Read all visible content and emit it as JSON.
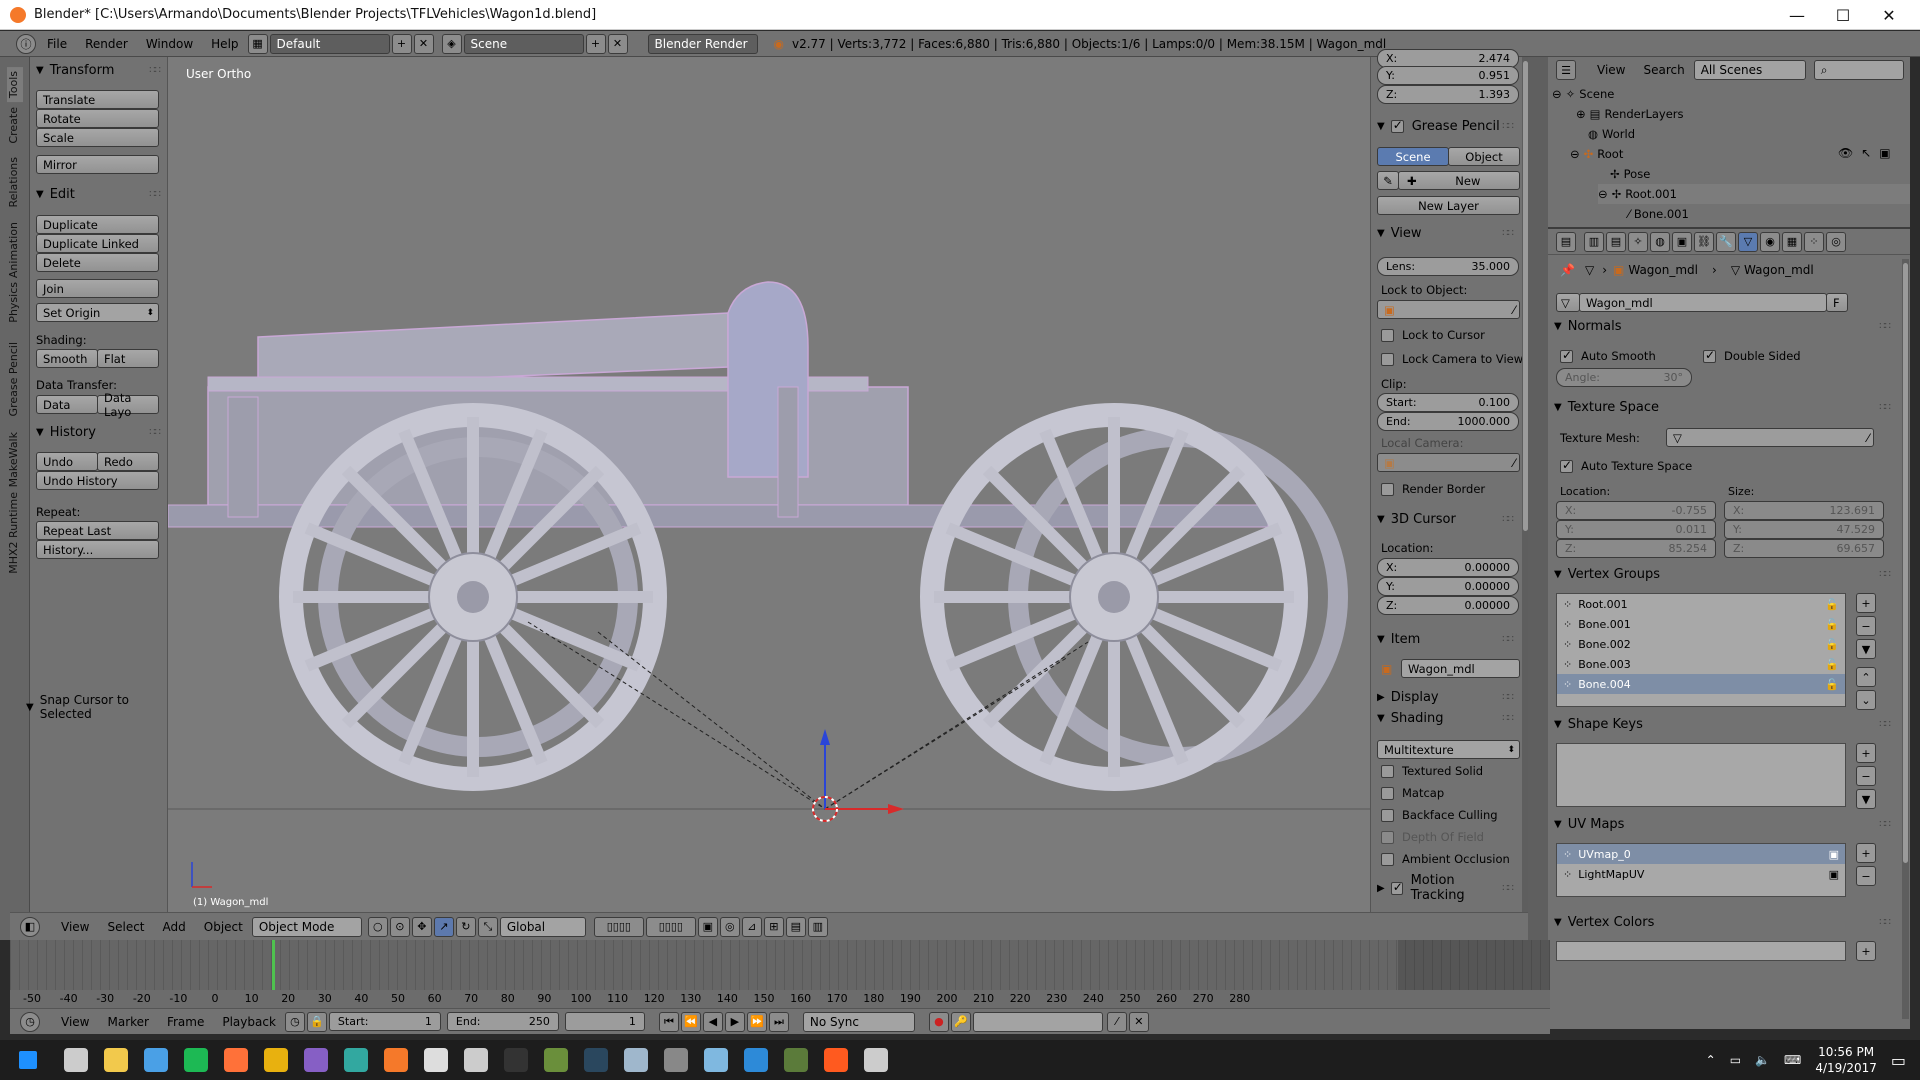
{
  "window": {
    "title": "Blender* [C:\\Users\\Armando\\Documents\\Blender Projects\\TFLVehicles\\Wagon1d.blend]",
    "minimize": "—",
    "maximize": "☐",
    "close": "✕"
  },
  "infobar": {
    "menus": [
      "File",
      "Render",
      "Window",
      "Help"
    ],
    "layout": "Default",
    "scene": "Scene",
    "engine": "Blender Render",
    "stats": "v2.77 | Verts:3,772 | Faces:6,880 | Tris:6,880 | Objects:1/6 | Lamps:0/0 | Mem:38.15M | Wagon_mdl"
  },
  "tool_tabs": [
    "Tools",
    "Create",
    "Relations",
    "Animation",
    "Physics",
    "Grease Pencil",
    "MakeWalk",
    "MHX2 Runtime"
  ],
  "tools": {
    "transform_title": "Transform",
    "transform": [
      "Translate",
      "Rotate",
      "Scale"
    ],
    "mirror": "Mirror",
    "edit_title": "Edit",
    "edit": [
      "Duplicate",
      "Duplicate Linked",
      "Delete"
    ],
    "join": "Join",
    "set_origin": "Set Origin",
    "shading_label": "Shading:",
    "smooth": "Smooth",
    "flat": "Flat",
    "data_transfer_label": "Data Transfer:",
    "data": "Data",
    "data_layo": "Data Layo",
    "history_title": "History",
    "undo": "Undo",
    "redo": "Redo",
    "undo_history": "Undo History",
    "repeat_label": "Repeat:",
    "repeat_last": "Repeat Last",
    "history_btn": "History...",
    "snap": "Snap Cursor to Selected"
  },
  "viewport": {
    "view_name": "User Ortho",
    "object_label": "(1) Wagon_mdl",
    "header": {
      "menus": [
        "View",
        "Select",
        "Add",
        "Object"
      ],
      "mode": "Object Mode",
      "orientation": "Global"
    }
  },
  "npanel": {
    "x_label": "X:",
    "x_val": "2.474",
    "y_label": "Y:",
    "y_val": "0.951",
    "z_label": "Z:",
    "z_val": "1.393",
    "grease_title": "Grease Pencil",
    "gp_scene": "Scene",
    "gp_object": "Object",
    "gp_new": "New",
    "gp_new_layer": "New Layer",
    "view_title": "View",
    "lens_label": "Lens:",
    "lens_val": "35.000",
    "lock_to_object": "Lock to Object:",
    "lock_cursor": "Lock to Cursor",
    "lock_camera": "Lock Camera to View",
    "clip_label": "Clip:",
    "clip_start_label": "Start:",
    "clip_start": "0.100",
    "clip_end_label": "End:",
    "clip_end": "1000.000",
    "local_camera": "Local Camera:",
    "render_border": "Render Border",
    "cursor_title": "3D Cursor",
    "cursor_location": "Location:",
    "cx": "0.00000",
    "cy": "0.00000",
    "cz": "0.00000",
    "item_title": "Item",
    "item_name": "Wagon_mdl",
    "display_title": "Display",
    "shading_title": "Shading",
    "shading_mode": "Multitexture",
    "textured_solid": "Textured Solid",
    "matcap": "Matcap",
    "backface": "Backface Culling",
    "dof": "Depth Of Field",
    "ao": "Ambient Occlusion",
    "motion_tracking": "Motion Tracking"
  },
  "outliner": {
    "view": "View",
    "search": "Search",
    "filter": "All Scenes",
    "rows": [
      "Scene",
      "RenderLayers",
      "World",
      "Root",
      "Pose",
      "Root.001",
      "Bone.001"
    ]
  },
  "props": {
    "breadcrumb_a": "Wagon_mdl",
    "breadcrumb_b": "Wagon_mdl",
    "datablock": "Wagon_mdl",
    "fake_user": "F",
    "normals_title": "Normals",
    "auto_smooth": "Auto Smooth",
    "double_sided": "Double Sided",
    "angle_label": "Angle:",
    "angle_val": "30°",
    "texspace_title": "Texture Space",
    "texture_mesh": "Texture Mesh:",
    "auto_texspace": "Auto Texture Space",
    "location_label": "Location:",
    "size_label": "Size:",
    "loc_x": "-0.755",
    "loc_y": "0.011",
    "loc_z": "85.254",
    "size_x": "123.691",
    "size_y": "47.529",
    "size_z": "69.657",
    "vgroups_title": "Vertex Groups",
    "vgroups": [
      "Root.001",
      "Bone.001",
      "Bone.002",
      "Bone.003",
      "Bone.004"
    ],
    "shapekeys_title": "Shape Keys",
    "uvmaps_title": "UV Maps",
    "uvmaps": [
      "UVmap_0",
      "LightMapUV"
    ],
    "vcolors_title": "Vertex Colors"
  },
  "timeline": {
    "ticks": [
      "-50",
      "-40",
      "-30",
      "-20",
      "-10",
      "0",
      "10",
      "20",
      "30",
      "40",
      "50",
      "60",
      "70",
      "80",
      "90",
      "100",
      "110",
      "120",
      "130",
      "140",
      "150",
      "160",
      "170",
      "180",
      "190",
      "200",
      "210",
      "220",
      "230",
      "240",
      "250",
      "260",
      "270",
      "280"
    ],
    "menus": [
      "View",
      "Marker",
      "Frame",
      "Playback"
    ],
    "start_label": "Start:",
    "start_val": "1",
    "end_label": "End:",
    "end_val": "250",
    "current": "1",
    "sync": "No Sync"
  },
  "taskbar": {
    "time": "10:56 PM",
    "date": "4/19/2017",
    "icons": [
      "windows-start",
      "task-view",
      "file-explorer",
      "store",
      "spotify",
      "firefox",
      "chrome",
      "visual-studio",
      "app-3",
      "blender",
      "unity",
      "settings",
      "epic-games",
      "app-tree",
      "steam",
      "app-bird",
      "app-circle",
      "app-paper",
      "app-box",
      "app-image",
      "app-r",
      "unreal"
    ],
    "icon_colors": [
      "#1e90ff",
      "#cccccc",
      "#f2c94c",
      "#4aa0e6",
      "#1db954",
      "#ff7139",
      "#e8b10f",
      "#865fc5",
      "#32a8a0",
      "#f5792a",
      "#dddddd",
      "#cccccc",
      "#333333",
      "#6a8f3b",
      "#2a475e",
      "#9fb7cc",
      "#888888",
      "#7fb8e0",
      "#2d8ad8",
      "#5b7b3a",
      "#ff5a1f",
      "#cccccc"
    ]
  }
}
